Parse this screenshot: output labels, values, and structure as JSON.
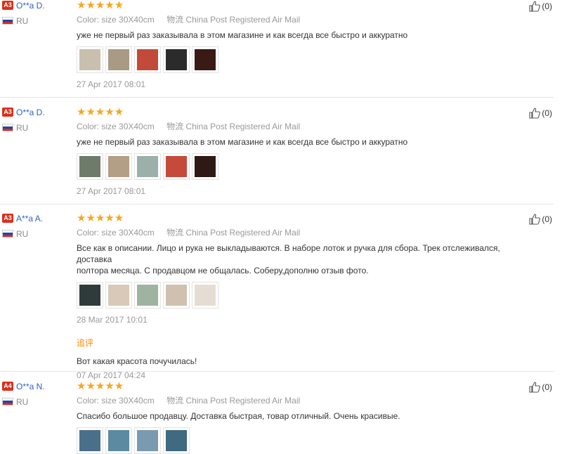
{
  "flag_colors": [
    "#ffffff",
    "#1c44b3",
    "#d52b1e"
  ],
  "helpful_icon": "thumbs-up-icon",
  "reviews": [
    {
      "badge": "A3",
      "name": "O**a D.",
      "country": "RU",
      "stars": "★★★★★",
      "color_label": "Color:",
      "color_value": "size 30X40cm",
      "shipping_label": "物流",
      "shipping_value": "China Post Registered Air Mail",
      "text": "уже не первый раз заказывала в этом магазине и как всегда все быстро и аккуратно",
      "photo_colors": [
        "#c9bfae",
        "#a89a83",
        "#c24a3a",
        "#2b2b2b",
        "#3a1a14"
      ],
      "date": "27 Apr 2017 08:01",
      "helpful": "(0)"
    },
    {
      "badge": "A3",
      "name": "O**a D.",
      "country": "RU",
      "stars": "★★★★★",
      "color_label": "Color:",
      "color_value": "size 30X40cm",
      "shipping_label": "物流",
      "shipping_value": "China Post Registered Air Mail",
      "text": "уже не первый раз заказывала в этом магазине и как всегда все быстро и аккуратно",
      "photo_colors": [
        "#6f7b6a",
        "#b39e86",
        "#9bb0a8",
        "#c54a3a",
        "#2e1a14"
      ],
      "date": "27 Apr 2017 08:01",
      "helpful": "(0)"
    },
    {
      "badge": "A3",
      "name": "A**a A.",
      "country": "RU",
      "stars": "★★★★★",
      "color_label": "Color:",
      "color_value": "size 30X40cm",
      "shipping_label": "物流",
      "shipping_value": "China Post Registered Air Mail",
      "text_lines": [
        "Все как в описании. Лицо и рука не выкладываются. В наборе лоток и ручка для сбора. Трек отслеживался, доставка",
        "полтора месяца. С продавцом не общалась. Соберу,дополню отзыв фото."
      ],
      "photo_colors": [
        "#2f3b3a",
        "#d8c9b8",
        "#9fb4a0",
        "#cfc0b0",
        "#e5ddd3"
      ],
      "date": "28 Mar 2017 10:01",
      "followup_label": "追评",
      "followup_text": "Вот какая красота почучилась!",
      "followup_date": "07 Apr 2017 04:24",
      "helpful": "(0)"
    },
    {
      "badge": "A4",
      "name": "O**a N.",
      "country": "RU",
      "stars": "★★★★★",
      "color_label": "Color:",
      "color_value": "size 30X40cm",
      "shipping_label": "物流",
      "shipping_value": "China Post Registered Air Mail",
      "text": "Спасибо большое продавцу. Доставка быстрая, товар отличный. Очень красивые.",
      "photo_colors": [
        "#4a6f8a",
        "#5c8aa0",
        "#7a9ab0",
        "#3f6a80"
      ],
      "helpful": "(0)"
    }
  ]
}
